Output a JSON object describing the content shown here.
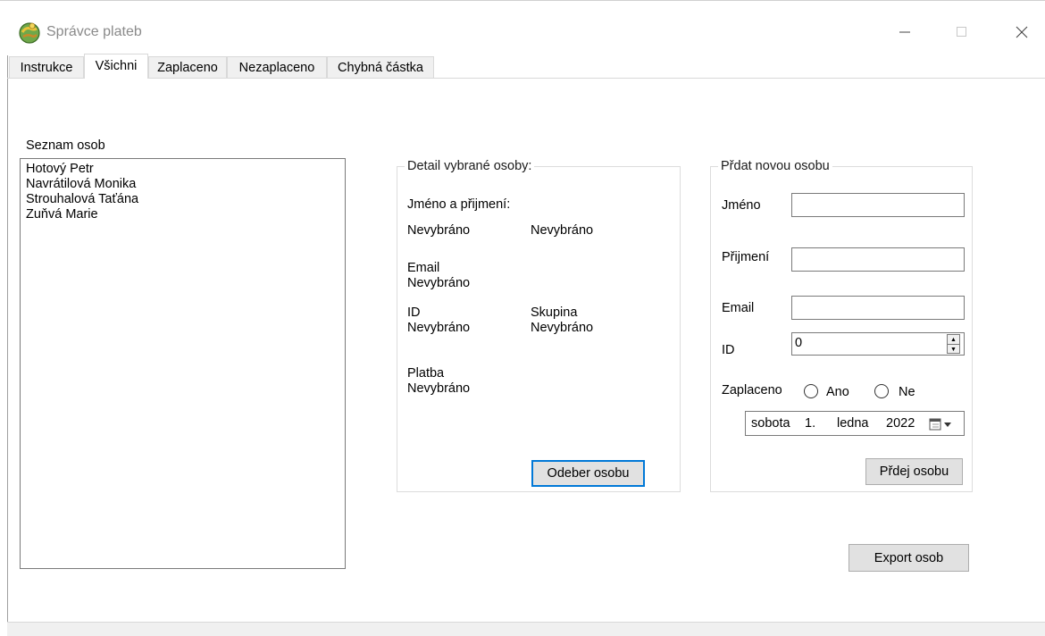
{
  "window": {
    "title": "Správce plateb"
  },
  "tabs": [
    {
      "label": "Instrukce",
      "active": false
    },
    {
      "label": "Všichni",
      "active": true
    },
    {
      "label": "Zaplaceno",
      "active": false
    },
    {
      "label": "Nezaplaceno",
      "active": false
    },
    {
      "label": "Chybná částka",
      "active": false
    }
  ],
  "person_list": {
    "label": "Seznam osob",
    "items": [
      "Hotový Petr",
      "Navrátilová Monika",
      "Strouhalová Taťána",
      "Zuňvá Marie"
    ]
  },
  "detail": {
    "group_title": "Detail vybrané osoby:",
    "name_label": "Jméno a přijmení:",
    "first_name_value": "Nevybráno",
    "last_name_value": "Nevybráno",
    "email_label": "Email",
    "email_value": "Nevybráno",
    "id_label": "ID",
    "id_value": "Nevybráno",
    "group_label": "Skupina",
    "group_value": "Nevybráno",
    "payment_label": "Platba",
    "payment_value": "Nevybráno",
    "remove_button": "Odeber osobu"
  },
  "add_person": {
    "group_title": "Přdat novou osobu",
    "first_name_label": "Jméno",
    "first_name_value": "",
    "last_name_label": "Přijmení",
    "last_name_value": "",
    "email_label": "Email",
    "email_value": "",
    "id_label": "ID",
    "id_value": "0",
    "paid_label": "Zaplaceno",
    "paid_yes": "Ano",
    "paid_no": "Ne",
    "date_day_name": "sobota",
    "date_day": "1.",
    "date_month": "ledna",
    "date_year": "2022",
    "add_button": "Přdej osobu"
  },
  "export_button": "Export osob"
}
